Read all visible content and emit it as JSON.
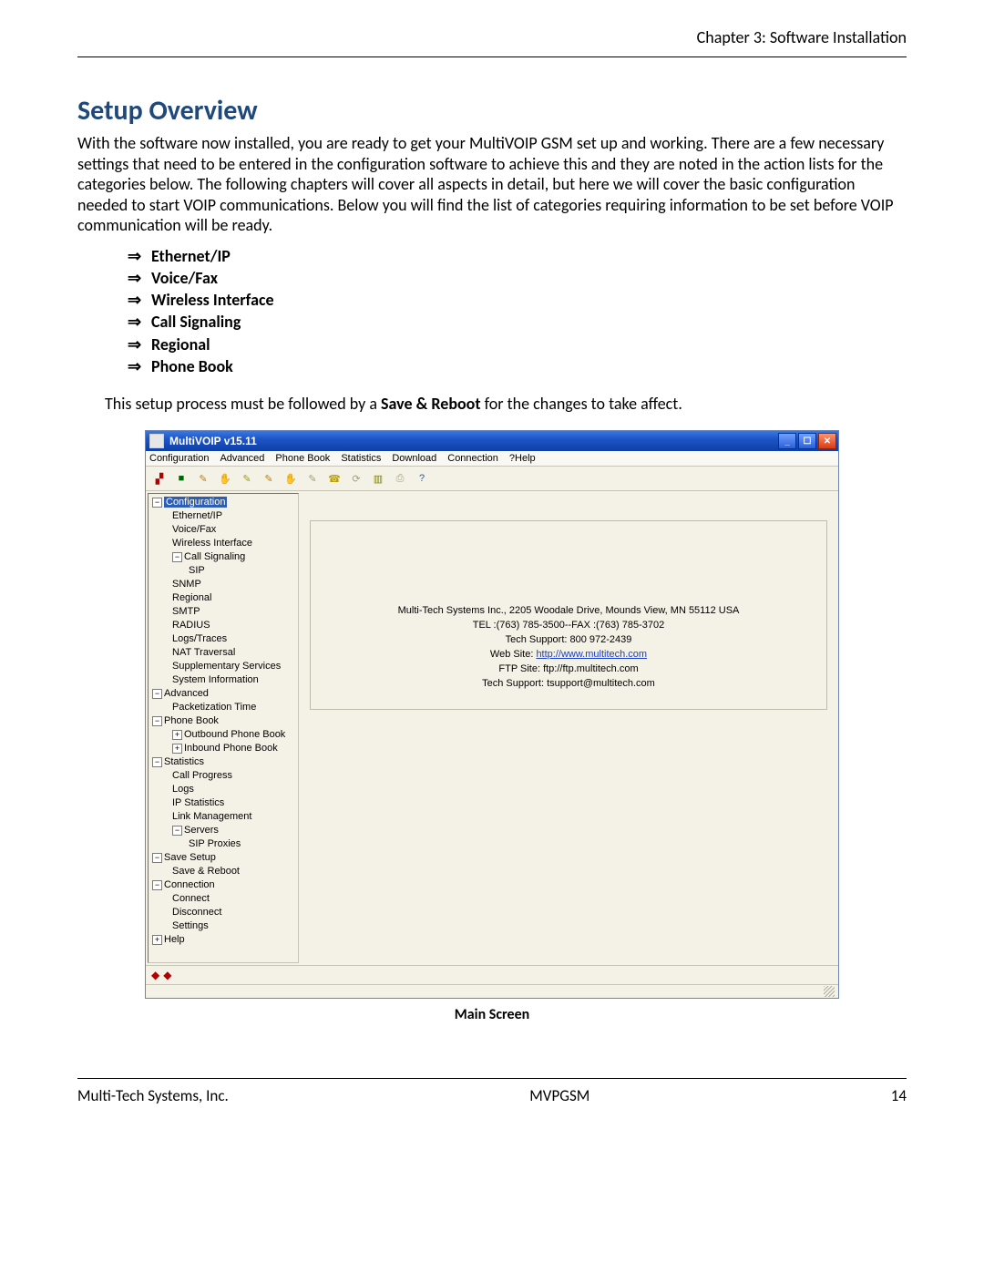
{
  "header": {
    "chapter": "Chapter 3: Software Installation"
  },
  "title": "Setup Overview",
  "intro": "With the software now installed, you are ready to get your MultiVOIP GSM set up and working. There are a few necessary settings that need to be entered in the configuration software to achieve this and they are noted in the action lists for the categories below. The following chapters will cover all aspects in detail, but here we will cover the basic configuration needed to start VOIP communications. Below you will find the list of categories requiring information to be set before VOIP communication will be ready.",
  "categories": [
    "Ethernet/IP",
    "Voice/Fax",
    "Wireless Interface",
    "Call Signaling",
    "Regional",
    "Phone Book"
  ],
  "save_reboot_line": {
    "prefix": "This setup process must be followed by a ",
    "bold": "Save & Reboot",
    "suffix": " for the changes to take affect."
  },
  "screenshot": {
    "title": "MultiVOIP v15.11",
    "menus": [
      "Configuration",
      "Advanced",
      "Phone Book",
      "Statistics",
      "Download",
      "Connection",
      "?Help"
    ],
    "tree": [
      {
        "label": "Configuration",
        "type": "minus",
        "lvl": 0,
        "sel": true
      },
      {
        "label": "Ethernet/IP",
        "lvl": 1
      },
      {
        "label": "Voice/Fax",
        "lvl": 1
      },
      {
        "label": "Wireless Interface",
        "lvl": 1
      },
      {
        "label": "Call Signaling",
        "type": "minus",
        "lvl": 1
      },
      {
        "label": "SIP",
        "lvl": 2
      },
      {
        "label": "SNMP",
        "lvl": 1
      },
      {
        "label": "Regional",
        "lvl": 1
      },
      {
        "label": "SMTP",
        "lvl": 1
      },
      {
        "label": "RADIUS",
        "lvl": 1
      },
      {
        "label": "Logs/Traces",
        "lvl": 1
      },
      {
        "label": "NAT Traversal",
        "lvl": 1
      },
      {
        "label": "Supplementary Services",
        "lvl": 1
      },
      {
        "label": "System Information",
        "lvl": 1
      },
      {
        "label": "Advanced",
        "type": "minus",
        "lvl": 0
      },
      {
        "label": "Packetization Time",
        "lvl": 1
      },
      {
        "label": "Phone Book",
        "type": "minus",
        "lvl": 0
      },
      {
        "label": "Outbound Phone Book",
        "type": "plus",
        "lvl": 1
      },
      {
        "label": "Inbound Phone Book",
        "type": "plus",
        "lvl": 1
      },
      {
        "label": "Statistics",
        "type": "minus",
        "lvl": 0
      },
      {
        "label": "Call Progress",
        "lvl": 1
      },
      {
        "label": "Logs",
        "lvl": 1
      },
      {
        "label": "IP Statistics",
        "lvl": 1
      },
      {
        "label": "Link Management",
        "lvl": 1
      },
      {
        "label": "Servers",
        "type": "minus",
        "lvl": 1
      },
      {
        "label": "SIP Proxies",
        "lvl": 2
      },
      {
        "label": "Save Setup",
        "type": "minus",
        "lvl": 0
      },
      {
        "label": "Save & Reboot",
        "lvl": 1
      },
      {
        "label": "Connection",
        "type": "minus",
        "lvl": 0
      },
      {
        "label": "Connect",
        "lvl": 1
      },
      {
        "label": "Disconnect",
        "lvl": 1
      },
      {
        "label": "Settings",
        "lvl": 1
      },
      {
        "label": "Help",
        "type": "plus",
        "lvl": 0
      }
    ],
    "info": {
      "line1": "Multi-Tech Systems Inc., 2205 Woodale Drive, Mounds View, MN 55112 USA",
      "line2": "TEL :(763) 785-3500--FAX :(763) 785-3702",
      "line3": "Tech Support: 800 972-2439",
      "line4_label": "Web Site: ",
      "line4_link": "http://www.multitech.com",
      "line5": "FTP Site: ftp://ftp.multitech.com",
      "line6": "Tech Support: tsupport@multitech.com"
    }
  },
  "caption": "Main Screen",
  "footer": {
    "left": "Multi-Tech Systems, Inc.",
    "center": "MVPGSM",
    "right": "14"
  }
}
